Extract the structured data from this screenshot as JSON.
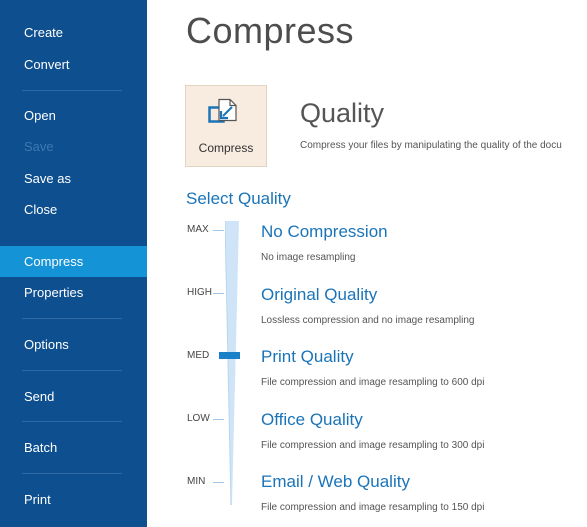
{
  "sidebar": {
    "items": [
      {
        "label": "Create"
      },
      {
        "label": "Convert"
      },
      {
        "label": "Open"
      },
      {
        "label": "Save"
      },
      {
        "label": "Save as"
      },
      {
        "label": "Close"
      },
      {
        "label": "Compress"
      },
      {
        "label": "Properties"
      },
      {
        "label": "Options"
      },
      {
        "label": "Send"
      },
      {
        "label": "Batch"
      },
      {
        "label": "Print"
      }
    ],
    "active": "Compress",
    "disabled": [
      "Save"
    ]
  },
  "main": {
    "title": "Compress",
    "tile_label": "Compress",
    "quality_heading": "Quality",
    "quality_description": "Compress your files by manipulating the quality of the docu",
    "select_quality_label": "Select Quality",
    "slider": {
      "levels": [
        "MAX",
        "HIGH",
        "MED",
        "LOW",
        "MIN"
      ],
      "selected": "MED"
    },
    "options": [
      {
        "title": "No Compression",
        "desc": "No image resampling"
      },
      {
        "title": "Original Quality",
        "desc": "Lossless compression and no image resampling"
      },
      {
        "title": "Print Quality",
        "desc": "File compression and image resampling to 600 dpi"
      },
      {
        "title": "Office Quality",
        "desc": "File compression and image resampling to 300 dpi"
      },
      {
        "title": "Email / Web Quality",
        "desc": "File compression and image resampling to 150 dpi"
      }
    ]
  },
  "colors": {
    "sidebar_bg": "#0e4f8f",
    "sidebar_active": "#1493d6",
    "accent": "#1a74b8",
    "tile_bg": "#f8ebe0"
  },
  "icons": {
    "tile": "compress-document-icon"
  }
}
